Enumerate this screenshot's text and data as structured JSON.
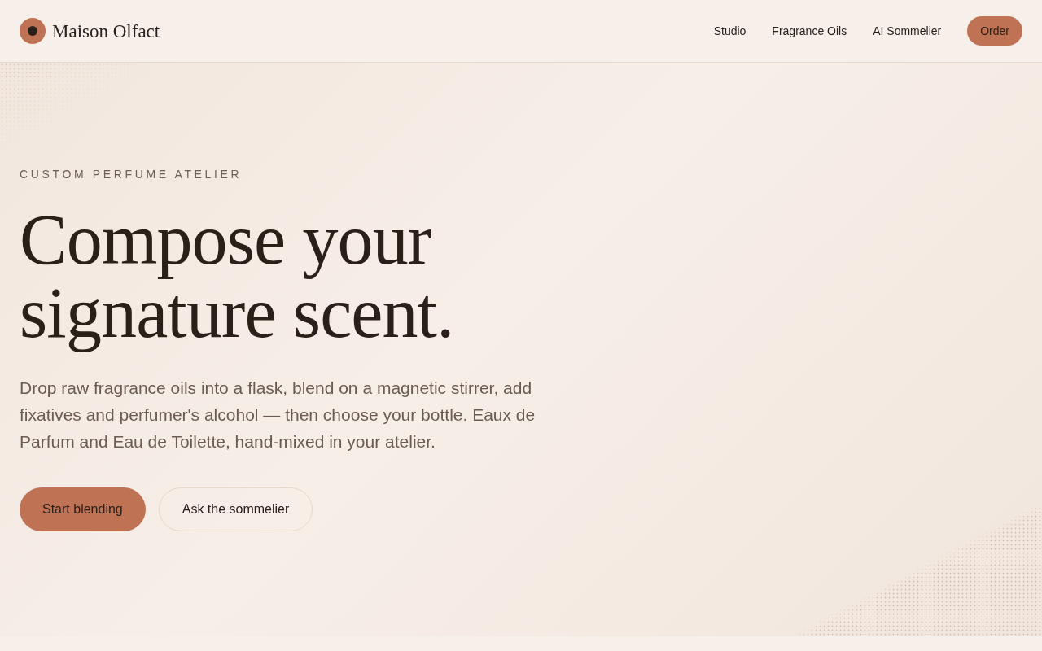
{
  "header": {
    "brand": "Maison Olfact",
    "nav": [
      "Studio",
      "Fragrance Oils",
      "AI Sommelier"
    ],
    "cta": "Order"
  },
  "hero": {
    "eyebrow": "CUSTOM PERFUME ATELIER",
    "title": "Compose your signature scent.",
    "description": "Drop raw fragrance oils into a flask, blend on a magnetic stirrer, add fixatives and perfumer's alcohol — then choose your bottle. Eaux de Parfum and Eau de Toilette, hand-mixed in your atelier.",
    "buttons": [
      {
        "label": "Start blending",
        "kind": "primary"
      },
      {
        "label": "Ask the sommelier",
        "kind": "secondary"
      }
    ]
  }
}
